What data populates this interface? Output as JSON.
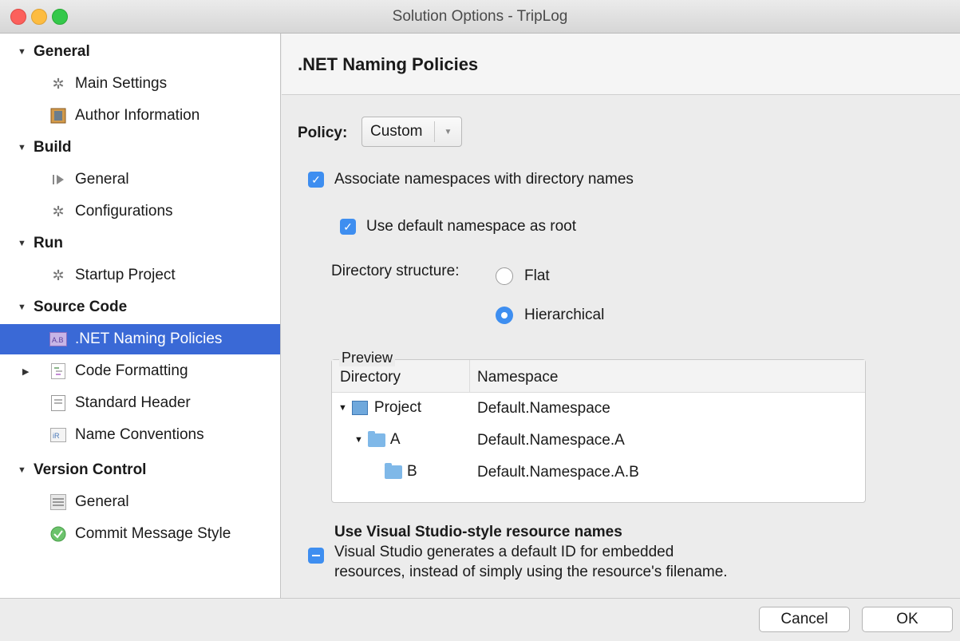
{
  "window": {
    "title": "Solution Options - TripLog"
  },
  "sidebar": {
    "categories": [
      {
        "label": "General",
        "items": [
          "Main Settings",
          "Author Information"
        ]
      },
      {
        "label": "Build",
        "items": [
          "General",
          "Configurations"
        ]
      },
      {
        "label": "Run",
        "items": [
          "Startup Project"
        ]
      },
      {
        "label": "Source Code",
        "items": [
          ".NET Naming Policies",
          "Code Formatting",
          "Standard Header",
          "Name Conventions"
        ]
      },
      {
        "label": "Version Control",
        "items": [
          "General",
          "Commit Message Style"
        ]
      }
    ],
    "selected": ".NET Naming Policies"
  },
  "main": {
    "heading": ".NET Naming Policies",
    "policy": {
      "label": "Policy:",
      "value": "Custom"
    },
    "associate_namespaces": {
      "label": "Associate namespaces with directory names",
      "checked": true
    },
    "default_namespace_root": {
      "label": "Use default namespace as root",
      "checked": true
    },
    "directory_structure": {
      "label": "Directory structure:",
      "options": [
        "Flat",
        "Hierarchical"
      ],
      "selected": "Hierarchical"
    },
    "preview": {
      "legend": "Preview",
      "columns": [
        "Directory",
        "Namespace"
      ],
      "rows": [
        {
          "directory": "Project",
          "namespace": "Default.Namespace"
        },
        {
          "directory": "A",
          "namespace": "Default.Namespace.A"
        },
        {
          "directory": "B",
          "namespace": "Default.Namespace.A.B"
        }
      ]
    },
    "resource_names": {
      "title": "Use Visual Studio-style resource names",
      "description_line1": "Visual Studio generates a default ID for embedded",
      "description_line2": "resources, instead of simply using the resource's filename.",
      "state": "mixed"
    }
  },
  "footer": {
    "cancel_label": "Cancel",
    "ok_label": "OK"
  },
  "colors": {
    "accent": "#3e8ef0",
    "selection": "#3a69d6"
  }
}
